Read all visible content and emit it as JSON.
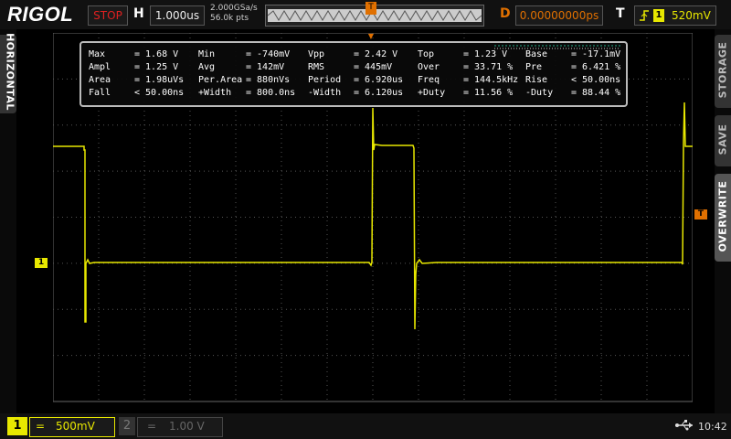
{
  "top": {
    "brand": "RIGOL",
    "run_state": "STOP",
    "h_label": "H",
    "timebase": "1.000us",
    "sample_rate": "2.000GSa/s",
    "mem_depth": "56.0k pts",
    "trig_pos_marker": "T",
    "d_label": "D",
    "delay": "0.00000000ps",
    "t_label": "T",
    "trigger_channel": "1",
    "trigger_level": "520mV",
    "trigger_edge_icon": "rising-edge-icon"
  },
  "side": {
    "left_tab": "HORIZONTAL",
    "right_tabs": [
      "STORAGE",
      "SAVE",
      "OVERWRITE"
    ]
  },
  "measurements": [
    [
      [
        "Max",
        "= 1.68 V"
      ],
      [
        "Min",
        "= -740mV"
      ],
      [
        "Vpp",
        "= 2.42 V"
      ],
      [
        "Top",
        "= 1.23 V"
      ],
      [
        "Base",
        "= -17.1mV"
      ]
    ],
    [
      [
        "Ampl",
        "= 1.25 V"
      ],
      [
        "Avg",
        "= 142mV"
      ],
      [
        "RMS",
        "= 445mV"
      ],
      [
        "Over",
        "= 33.71 %"
      ],
      [
        "Pre",
        "= 6.421 %"
      ]
    ],
    [
      [
        "Area",
        "= 1.98uVs"
      ],
      [
        "Per.Area",
        "= 880nVs"
      ],
      [
        "Period",
        "= 6.920us"
      ],
      [
        "Freq",
        "= 144.5kHz"
      ],
      [
        "Rise",
        "< 50.00ns"
      ]
    ],
    [
      [
        "Fall",
        "< 50.00ns"
      ],
      [
        "+Width",
        "= 800.0ns"
      ],
      [
        "-Width",
        "= 6.120us"
      ],
      [
        "+Duty",
        "= 11.56 %"
      ],
      [
        "-Duty",
        "= 88.44 %"
      ]
    ]
  ],
  "markers": {
    "ch1": "1",
    "trigger_level": "T"
  },
  "bottom": {
    "ch1_num": "1",
    "ch1_coupling": "=",
    "ch1_scale": "500mV",
    "ch2_num": "2",
    "ch2_coupling": "=",
    "ch2_scale": "1.00 V",
    "time": "10:42"
  },
  "colors": {
    "ch1": "#e8e800",
    "trigger": "#e07000",
    "stop": "#e02020",
    "grid": "#555555"
  }
}
